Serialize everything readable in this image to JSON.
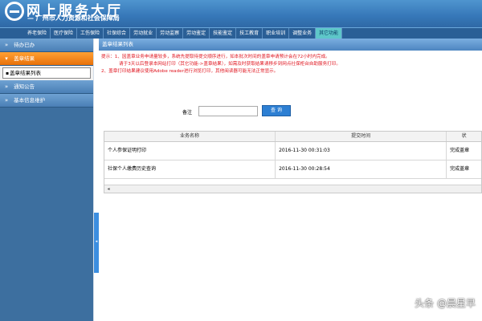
{
  "header": {
    "title": "网上服务大厅",
    "subtitle": "— 广州市人力资源和社会保障局"
  },
  "topnav": {
    "items": [
      "养老保险",
      "医疗保险",
      "工伤保险",
      "社保综合",
      "劳动就业",
      "劳动监察",
      "劳动鉴定",
      "技能鉴定",
      "技工教育",
      "职业培训",
      "调整业务",
      "其它功能"
    ],
    "active_index": 11
  },
  "sidebar": {
    "items": [
      {
        "label": "待办已办",
        "arrow": "»"
      },
      {
        "label": "盖章结果",
        "arrow": "▾"
      },
      {
        "label": "通知公告",
        "arrow": "»"
      },
      {
        "label": "基本信息维护",
        "arrow": "»"
      }
    ],
    "sub_items": [
      {
        "label": "盖章结果列表"
      }
    ]
  },
  "splitter": {
    "label": "◂"
  },
  "panel": {
    "title": "盖章结果列表",
    "notice_lines": [
      "提示：1、因盖章业务申请量较多，系统先提取待提交顺序进行，如本批次时间的盖章申请预计会在72小时内完成。",
      "请于3天以后登录本网站打印（其它功能->盖章结果），如需及时获取结果请移步到网点社保柜台自助服务打印。",
      "2、盖章打印结果建议使用Adobe reader进行浏览打印，其他阅读器可能无法正常显示。"
    ]
  },
  "query": {
    "label": "备注",
    "value": "",
    "button": "查 询"
  },
  "table": {
    "headers": [
      "业务名称",
      "提交时间",
      "状"
    ],
    "rows": [
      {
        "name": "个人参保证明打印",
        "time": "2016-11-30 00:31:03",
        "status": "完成盖章"
      },
      {
        "name": "社保个人缴费历史查询",
        "time": "2016-11-30 00:28:54",
        "status": "完成盖章"
      }
    ],
    "scroll_arrow": "◂"
  },
  "watermark": "头条 @晨星早"
}
